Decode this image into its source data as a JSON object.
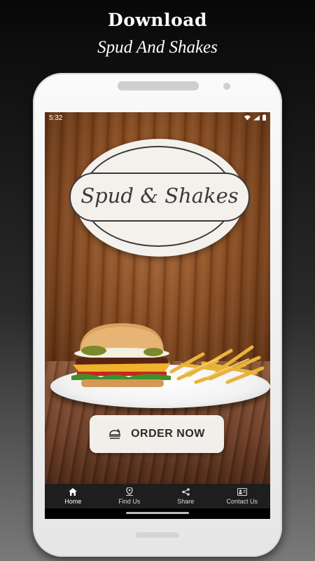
{
  "promo": {
    "title": "Download",
    "subtitle": "Spud And Shakes"
  },
  "status_bar": {
    "time": "5:32",
    "icons": [
      "wifi-icon",
      "signal-icon",
      "battery-icon"
    ]
  },
  "logo": {
    "text": "Spud & Shakes"
  },
  "order_button": {
    "label": "ORDER NOW",
    "icon": "food-delivery-icon"
  },
  "bottom_nav": {
    "items": [
      {
        "label": "Home",
        "icon": "home-icon",
        "active": true
      },
      {
        "label": "Find Us",
        "icon": "location-pin-icon",
        "active": false
      },
      {
        "label": "Share",
        "icon": "share-icon",
        "active": false
      },
      {
        "label": "Contact Us",
        "icon": "contact-card-icon",
        "active": false
      }
    ]
  },
  "colors": {
    "nav_background": "#1e1e1e",
    "button_background": "#f2efea",
    "wood": "#8a4f25"
  }
}
